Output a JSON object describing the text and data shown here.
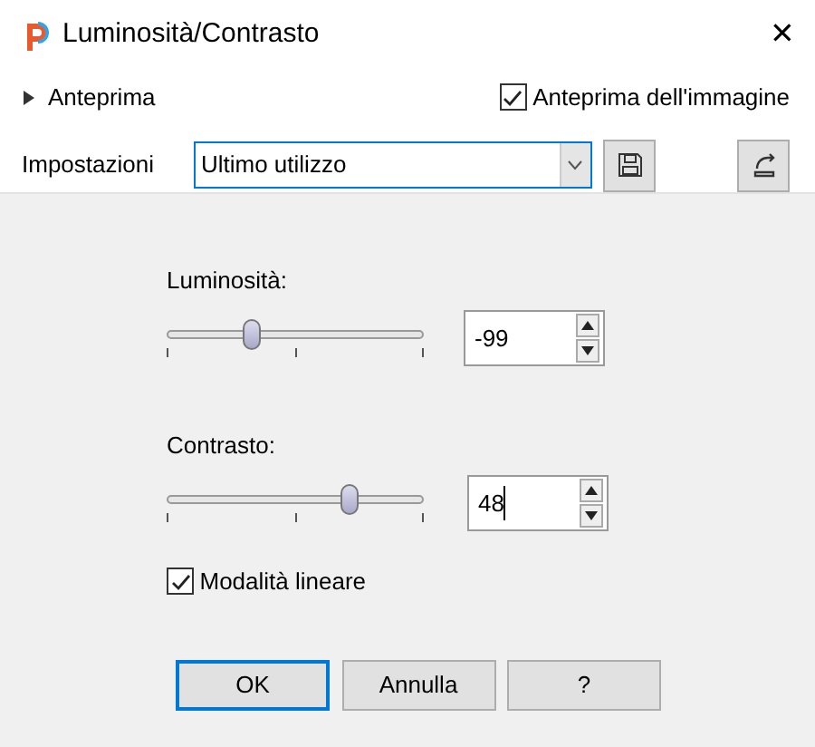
{
  "window": {
    "title": "Luminosità/Contrasto",
    "close": "✕"
  },
  "preview": {
    "label": "Anteprima",
    "expanded": false,
    "image_preview": {
      "label": "Anteprima dell'immagine",
      "checked": true
    }
  },
  "settings": {
    "label": "Impostazioni",
    "value": "Ultimo utilizzo"
  },
  "controls": [
    {
      "label": "Luminosità:",
      "level": 0.33,
      "value": "-99",
      "focused": false
    },
    {
      "label": "Contrasto:",
      "level": 0.71,
      "value": "48",
      "focused": true
    }
  ],
  "linear_mode": {
    "label": "Modalità lineare",
    "checked": true
  },
  "buttons": [
    {
      "label": "OK",
      "default": true
    },
    {
      "label": "Annulla",
      "default": false
    },
    {
      "label": "?",
      "default": false
    }
  ]
}
